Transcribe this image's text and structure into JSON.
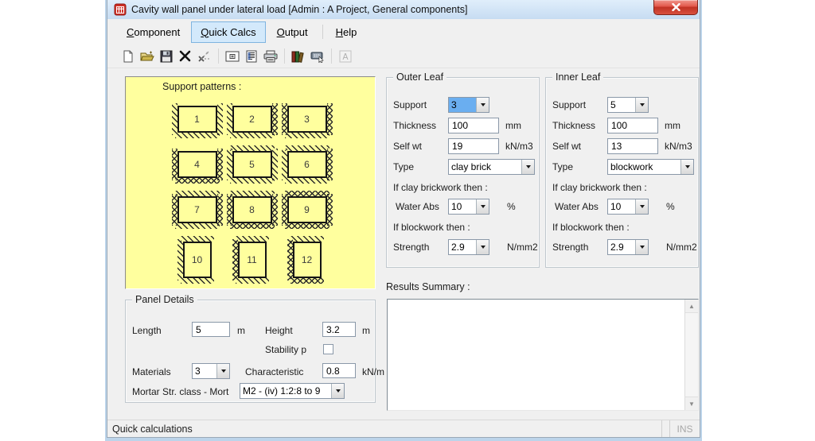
{
  "window": {
    "title": "Cavity wall panel under lateral load [Admin : A Project, General components]",
    "status_left": "Quick calculations",
    "status_right": "INS"
  },
  "menu": {
    "items": [
      {
        "label": "Component",
        "selected": false
      },
      {
        "label": "Quick Calcs",
        "selected": true
      },
      {
        "label": "Output",
        "selected": false
      },
      {
        "label": "Help",
        "selected": false
      }
    ]
  },
  "toolbar": {
    "icons": [
      "new-document",
      "open-folder",
      "save-floppy",
      "delete-x",
      "datum-point",
      "properties-dialog",
      "report-document",
      "printer",
      "library-books",
      "quick-keypad",
      "font-a-disabled"
    ]
  },
  "support_patterns": {
    "label": "Support patterns :",
    "items": [
      {
        "n": "1",
        "shape": "landscape",
        "edges": {
          "top": "",
          "left": "h",
          "right": "h",
          "bottom": "h"
        }
      },
      {
        "n": "2",
        "shape": "landscape",
        "edges": {
          "top": "",
          "left": "h",
          "right": "x",
          "bottom": "h"
        }
      },
      {
        "n": "3",
        "shape": "landscape",
        "edges": {
          "top": "",
          "left": "x",
          "right": "x",
          "bottom": "h"
        }
      },
      {
        "n": "4",
        "shape": "landscape",
        "edges": {
          "top": "",
          "left": "x",
          "right": "x",
          "bottom": "x"
        }
      },
      {
        "n": "5",
        "shape": "landscape",
        "edges": {
          "top": "h",
          "left": "h",
          "right": "h",
          "bottom": "h"
        }
      },
      {
        "n": "6",
        "shape": "landscape",
        "edges": {
          "top": "h",
          "left": "h",
          "right": "x",
          "bottom": "h"
        }
      },
      {
        "n": "7",
        "shape": "landscape",
        "edges": {
          "top": "h",
          "left": "x",
          "right": "x",
          "bottom": "h"
        }
      },
      {
        "n": "8",
        "shape": "landscape",
        "edges": {
          "top": "h",
          "left": "x",
          "right": "x",
          "bottom": "x"
        }
      },
      {
        "n": "9",
        "shape": "landscape",
        "edges": {
          "top": "x",
          "left": "x",
          "right": "x",
          "bottom": "x"
        }
      },
      {
        "n": "10",
        "shape": "portrait",
        "edges": {
          "top": "h",
          "left": "h",
          "right": "",
          "bottom": "h"
        }
      },
      {
        "n": "11",
        "shape": "portrait",
        "edges": {
          "top": "h",
          "left": "x",
          "right": "",
          "bottom": "h"
        }
      },
      {
        "n": "12",
        "shape": "portrait",
        "edges": {
          "top": "h",
          "left": "x",
          "right": "",
          "bottom": "x"
        }
      }
    ]
  },
  "outer_leaf": {
    "title": "Outer Leaf",
    "support": {
      "label": "Support",
      "value": "3"
    },
    "thickness": {
      "label": "Thickness",
      "value": "100",
      "unit": "mm"
    },
    "self_wt": {
      "label": "Self wt",
      "value": "19",
      "unit": "kN/m3"
    },
    "type": {
      "label": "Type",
      "value": "clay brick"
    },
    "clay_note": "If clay brickwork then :",
    "water_abs": {
      "label": "Water Abs",
      "value": "10",
      "unit": "%"
    },
    "block_note": "If blockwork then :",
    "strength": {
      "label": "Strength",
      "value": "2.9",
      "unit": "N/mm2"
    }
  },
  "inner_leaf": {
    "title": "Inner Leaf",
    "support": {
      "label": "Support",
      "value": "5"
    },
    "thickness": {
      "label": "Thickness",
      "value": "100",
      "unit": "mm"
    },
    "self_wt": {
      "label": "Self wt",
      "value": "13",
      "unit": "kN/m3"
    },
    "type": {
      "label": "Type",
      "value": "blockwork"
    },
    "clay_note": "If clay brickwork then :",
    "water_abs": {
      "label": "Water Abs",
      "value": "10",
      "unit": "%"
    },
    "block_note": "If blockwork then :",
    "strength": {
      "label": "Strength",
      "value": "2.9",
      "unit": "N/mm2"
    }
  },
  "panel_details": {
    "title": "Panel Details",
    "length": {
      "label": "Length",
      "value": "5",
      "unit": "m"
    },
    "height": {
      "label": "Height",
      "value": "3.2",
      "unit": "m"
    },
    "stability": {
      "label": "Stability p",
      "checked": false
    },
    "materials": {
      "label": "Materials",
      "value": "3"
    },
    "characteristic": {
      "label": "Characteristic",
      "value": "0.8",
      "unit": "kN/m"
    },
    "mortar": {
      "label": "Mortar Str. class - Mort",
      "value": "M2 - (iv) 1:2:8 to 9"
    }
  },
  "results": {
    "label": "Results Summary :",
    "content": ""
  }
}
